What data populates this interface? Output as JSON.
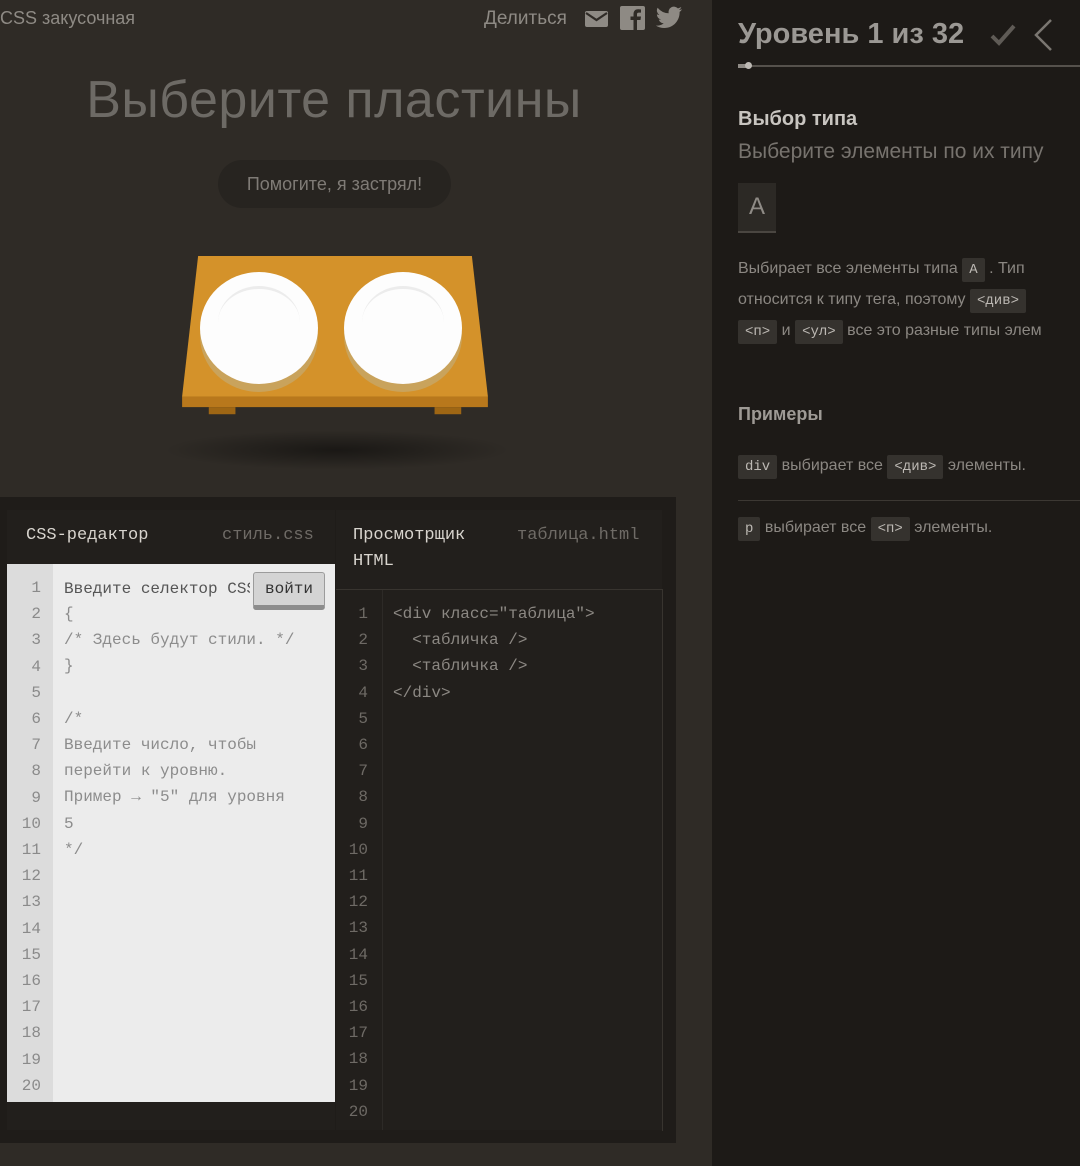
{
  "header": {
    "app_title": "CSS закусочная",
    "share_label": "Делиться",
    "icons": [
      "mail-icon",
      "facebook-icon",
      "twitter-icon"
    ]
  },
  "level": {
    "instruction": "Выберите пластины",
    "help_button": "Помогите, я застрял!"
  },
  "css_editor": {
    "title": "CSS-редактор",
    "file": "стиль.css",
    "input_placeholder": "Введите селектор CSS",
    "enter_button": "войти",
    "lines": [
      "{",
      "/* Здесь будут стили. */",
      "}",
      "",
      "/*",
      "Введите число, чтобы",
      "перейти к уровню.",
      "Пример → \"5\" для уровня",
      "5",
      "*/"
    ],
    "line_numbers": [
      "1",
      "2",
      "3",
      "4",
      "5",
      "6",
      "7",
      "8",
      "9",
      "10",
      "11",
      "12",
      "13",
      "14",
      "15",
      "16",
      "17",
      "18",
      "19",
      "20"
    ]
  },
  "html_viewer": {
    "title_line1": "Просмотрщик",
    "title_line2": "HTML",
    "file": "таблица.html",
    "lines": [
      "<div класс=\"таблица\">",
      "  <табличка />",
      "  <табличка />",
      "</div>"
    ],
    "line_numbers": [
      "1",
      "2",
      "3",
      "4",
      "5",
      "6",
      "7",
      "8",
      "9",
      "10",
      "11",
      "12",
      "13",
      "14",
      "15",
      "16",
      "17",
      "18",
      "19",
      "20"
    ]
  },
  "sidebar": {
    "level_title": "Уровень 1 из 32",
    "progress_fraction": 0.0313,
    "selector_name": "Выбор типа",
    "selector_description": "Выберите элементы по их типу",
    "syntax": "A",
    "hint": {
      "line1_a": "Выбирает все элементы типа",
      "line1_tag": "A",
      "line1_b": ". Тип",
      "line2_a": "относится к типу тега, поэтому",
      "line2_tag": "<див>",
      "line3_tag1": "<п>",
      "line3_and": "и",
      "line3_tag2": "<ул>",
      "line3_b": "все это разные типы элем"
    },
    "examples_title": "Примеры",
    "examples": [
      {
        "code": "div",
        "a": "выбирает все",
        "tag": "<див>",
        "b": "элементы."
      },
      {
        "code": "p",
        "a": "выбирает все",
        "tag": "<п>",
        "b": "элементы."
      }
    ],
    "colors": {
      "table": "#d4922a",
      "plate": "#fdfdfd",
      "background": "#2f2b26",
      "sidebar": "#1d1a17"
    }
  }
}
